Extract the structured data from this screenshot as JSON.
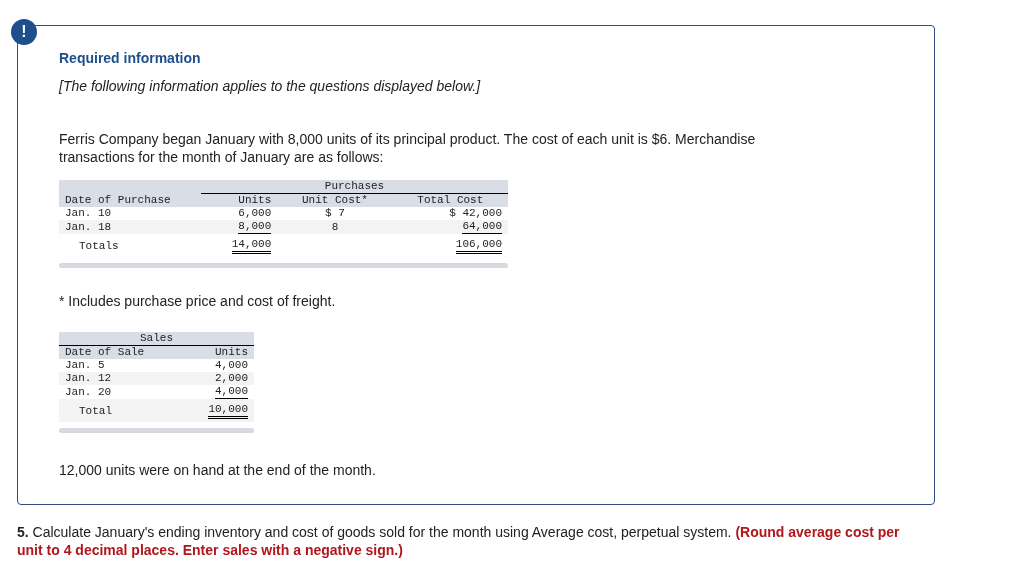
{
  "alert": {
    "icon": "!",
    "title": "Required information",
    "subtitle": "[The following information applies to the questions displayed below.]"
  },
  "intro": "Ferris Company began January with 8,000 units of its principal product. The cost of each unit is $6. Merchandise transactions for the month of January are as follows:",
  "purchases_table": {
    "group_heading": "Purchases",
    "columns": [
      "Date of Purchase",
      "Units",
      "Unit Cost*",
      "Total Cost"
    ],
    "rows": [
      [
        "Jan. 10",
        "6,000",
        "$ 7",
        "$ 42,000"
      ],
      [
        "Jan. 18",
        "8,000",
        "8",
        "64,000"
      ]
    ],
    "totals": {
      "label": "Totals",
      "units": "14,000",
      "total_cost": "106,000"
    }
  },
  "footnote": "* Includes purchase price and cost of freight.",
  "sales_table": {
    "group_heading": "Sales",
    "columns": [
      "Date of Sale",
      "Units"
    ],
    "rows": [
      [
        "Jan. 5",
        "4,000"
      ],
      [
        "Jan. 12",
        "2,000"
      ],
      [
        "Jan. 20",
        "4,000"
      ]
    ],
    "totals": [
      "Total",
      "10,000"
    ]
  },
  "closing": "12,000 units were on hand at the end of the month.",
  "question": {
    "number": "5.",
    "text": "Calculate January's ending inventory and cost of goods sold for the month using Average cost, perpetual system.",
    "note": "(Round average cost per unit to 4 decimal places. Enter sales with a negative sign.)"
  }
}
